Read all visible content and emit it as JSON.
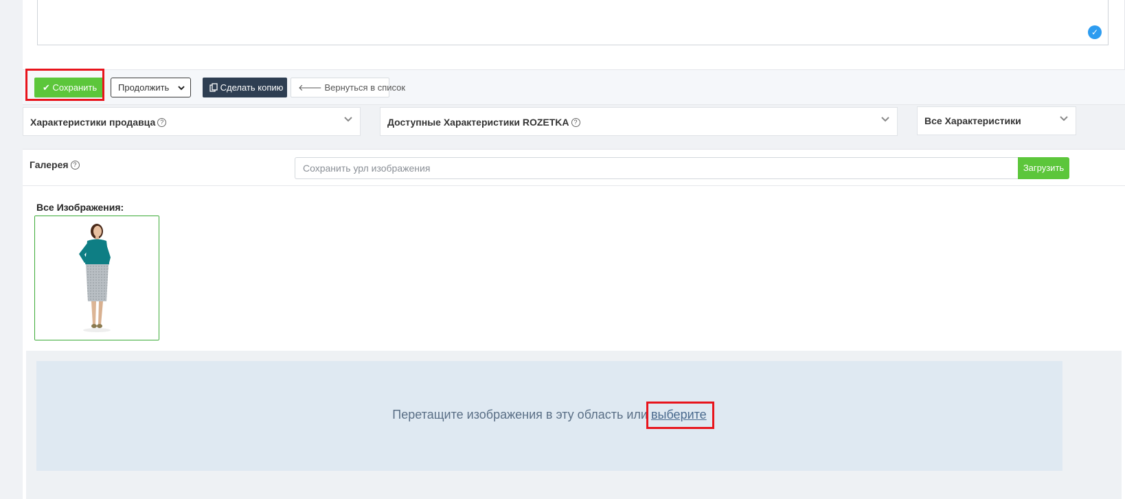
{
  "form": {
    "save_label": "Сохранить",
    "continue_label": "Продолжить",
    "copy_label": "Сделать копию",
    "back_label": "Вернуться в список"
  },
  "accordions": {
    "seller": "Характеристики продавца",
    "rozetka": "Доступные Характеристики ROZETKA",
    "all": "Все Характеристики"
  },
  "gallery": {
    "title": "Галерея",
    "url_placeholder": "Сохранить урл изображения",
    "upload_label": "Загрузить",
    "all_images_label": "Все Изображения:",
    "drop_text": "Перетащите изображения в эту область или ",
    "drop_link": "выберите"
  },
  "icons": {
    "save": "checkmark-icon",
    "continue": "chevron-down-icon",
    "copy": "copy-icon",
    "back": "arrow-left-icon",
    "help": "question-circle-icon"
  },
  "colors": {
    "primary_green": "#5cc63b",
    "dark_button": "#2e3e52",
    "highlight_red": "#e8141c",
    "drop_zone": "#dfe9f2"
  }
}
